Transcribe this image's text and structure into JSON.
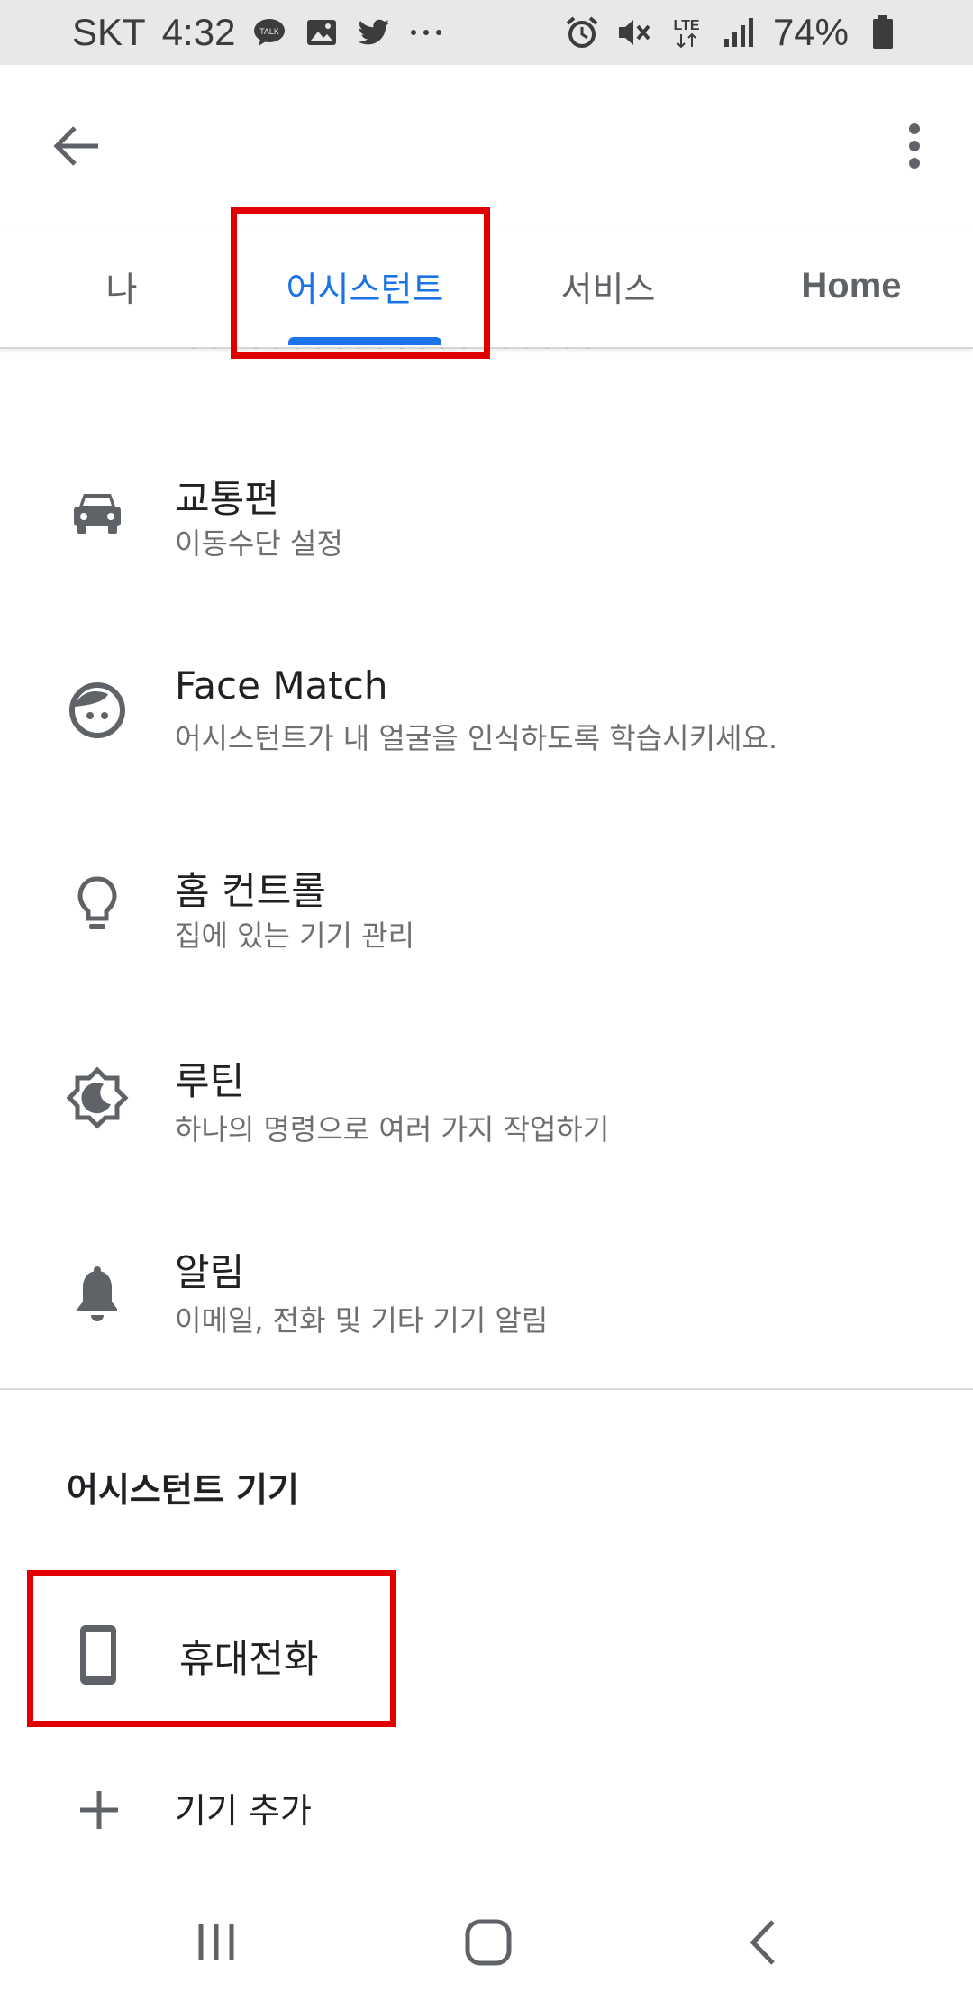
{
  "status_bar": {
    "carrier": "SKT",
    "time": "4:32",
    "network": "LTE",
    "battery": "74%",
    "left_icons": [
      "kakaotalk-icon",
      "gallery-icon",
      "twitter-icon",
      "more-dots-icon"
    ],
    "right_icons": [
      "alarm-icon",
      "mute-icon",
      "lte-icon",
      "signal-icon",
      "battery-icon"
    ]
  },
  "tabs": [
    {
      "label": "나"
    },
    {
      "label": "어시스턴트",
      "active": true
    },
    {
      "label": "서비스"
    },
    {
      "label": "Home"
    }
  ],
  "items": [
    {
      "title": "교통편",
      "subtitle": "이동수단 설정",
      "icon": "car-icon"
    },
    {
      "title": "Face Match",
      "subtitle": "어시스턴트가 내 얼굴을 인식하도록 학습시키세요.",
      "icon": "face-icon"
    },
    {
      "title": "홈 컨트롤",
      "subtitle": "집에 있는 기기 관리",
      "icon": "lightbulb-icon"
    },
    {
      "title": "루틴",
      "subtitle": "하나의 명령으로 여러 가지 작업하기",
      "icon": "routine-icon"
    },
    {
      "title": "알림",
      "subtitle": "이메일, 전화 및 기타 기기 알림",
      "icon": "bell-icon"
    }
  ],
  "section": {
    "header": "어시스턴트 기기"
  },
  "devices": [
    {
      "label": "휴대전화",
      "icon": "phone-icon"
    }
  ],
  "add_device": {
    "label": "기기 추가",
    "icon": "plus-icon"
  },
  "colors": {
    "accent": "#1a73e8",
    "highlight": "#e00000",
    "icon_gray": "#5f6368"
  }
}
